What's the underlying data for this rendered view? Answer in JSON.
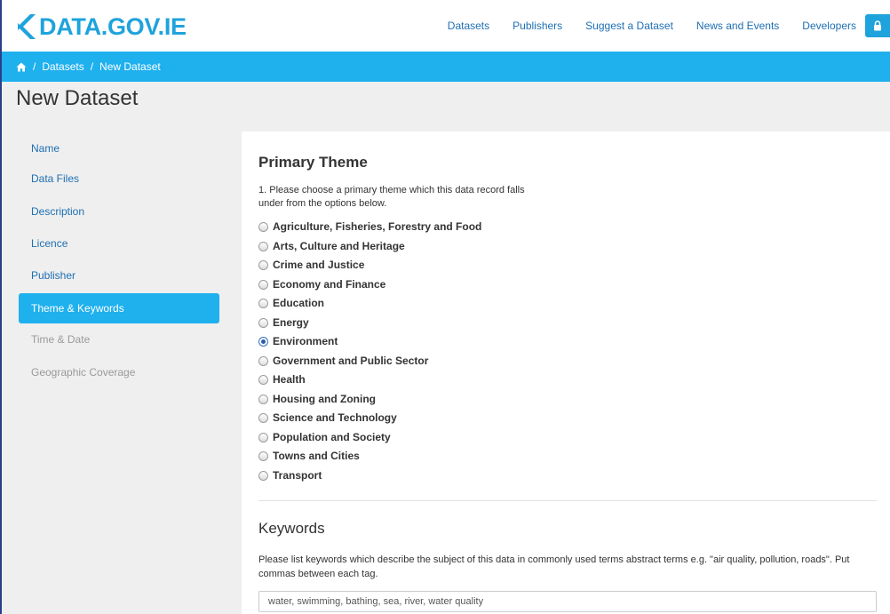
{
  "header": {
    "logo_text": "DATA.GOV.IE",
    "nav": [
      {
        "label": "Datasets"
      },
      {
        "label": "Publishers"
      },
      {
        "label": "Suggest a Dataset"
      },
      {
        "label": "News and Events"
      },
      {
        "label": "Developers"
      }
    ],
    "lock_icon": "lock-icon"
  },
  "breadcrumb": {
    "home_icon": "home-icon",
    "items": [
      "Datasets",
      "New Dataset"
    ]
  },
  "page": {
    "title": "New Dataset"
  },
  "sidebar": {
    "items": [
      {
        "label": "Name"
      },
      {
        "label": "Data Files"
      },
      {
        "label": "Description"
      },
      {
        "label": "Licence"
      },
      {
        "label": "Publisher"
      },
      {
        "label": "Theme & Keywords"
      },
      {
        "label": "Time & Date"
      },
      {
        "label": "Geographic Coverage"
      }
    ],
    "active": "Theme & Keywords"
  },
  "primary_theme": {
    "heading": "Primary Theme",
    "instructions": "1. Please choose a primary theme which this data record falls under from the options below.",
    "options": [
      {
        "label": "Agriculture, Fisheries, Forestry and Food"
      },
      {
        "label": "Arts, Culture and Heritage"
      },
      {
        "label": "Crime and Justice"
      },
      {
        "label": "Economy and Finance"
      },
      {
        "label": "Education"
      },
      {
        "label": "Energy"
      },
      {
        "label": "Environment"
      },
      {
        "label": "Government and Public Sector"
      },
      {
        "label": "Health"
      },
      {
        "label": "Housing and Zoning"
      },
      {
        "label": "Science and Technology"
      },
      {
        "label": "Population and Society"
      },
      {
        "label": "Towns and Cities"
      },
      {
        "label": "Transport"
      }
    ],
    "selected": "Environment"
  },
  "keywords": {
    "heading": "Keywords",
    "help": "Please list keywords which describe the subject of this data in commonly used terms abstract terms e.g. \"air quality, pollution, roads\". Put commas between each tag.",
    "value": "water, swimming, bathing, sea, river, water quality"
  },
  "colors": {
    "brand": "#1fa3dc",
    "breadcrumb_bar": "#1fb0ee",
    "link": "#1e6fb3",
    "sidebar_bg": "#efefef"
  }
}
